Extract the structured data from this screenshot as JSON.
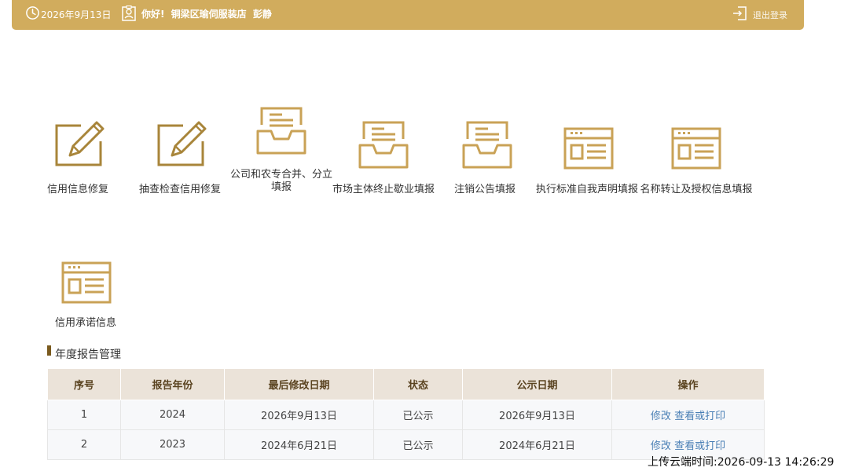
{
  "header": {
    "date": "2026年9月13日",
    "greeting": "你好!",
    "shop_name": "铜梁区瑜伺服装店",
    "user_name": "彭静",
    "logout_label": "退出登录"
  },
  "tiles": [
    {
      "label": "信用信息修复",
      "icon": "edit-icon"
    },
    {
      "label": "抽查检查信用修复",
      "icon": "edit-icon"
    },
    {
      "label": "公司和农专合并、分立填报",
      "icon": "inbox-tray-icon"
    },
    {
      "label": "市场主体终止歇业填报",
      "icon": "inbox-tray-icon"
    },
    {
      "label": "注销公告填报",
      "icon": "inbox-tray-icon"
    },
    {
      "label": "执行标准自我声明填报",
      "icon": "browser-window-icon"
    },
    {
      "label": "名称转让及授权信息填报",
      "icon": "browser-window-icon"
    },
    {
      "label": "信用承诺信息",
      "icon": "browser-window-icon"
    }
  ],
  "annual_report": {
    "title": "年度报告管理",
    "columns": [
      "序号",
      "报告年份",
      "最后修改日期",
      "状态",
      "公示日期",
      "操作"
    ],
    "rows": [
      {
        "no": "1",
        "year": "2024",
        "modified": "2026年9月13日",
        "status": "已公示",
        "publish": "2026年9月13日",
        "edit": "修改",
        "view": "查看或打印"
      },
      {
        "no": "2",
        "year": "2023",
        "modified": "2024年6月21日",
        "status": "已公示",
        "publish": "2024年6月21日",
        "edit": "修改",
        "view": "查看或打印"
      }
    ]
  },
  "upload_time": "上传云端时间:2026-09-13 14:26:29",
  "colors": {
    "accent": "#d1ac5d",
    "icon_gold": "#c9a256",
    "icon_dark": "#a8853a",
    "header_row": "#ebe3d9",
    "link": "#4a7fb5"
  }
}
